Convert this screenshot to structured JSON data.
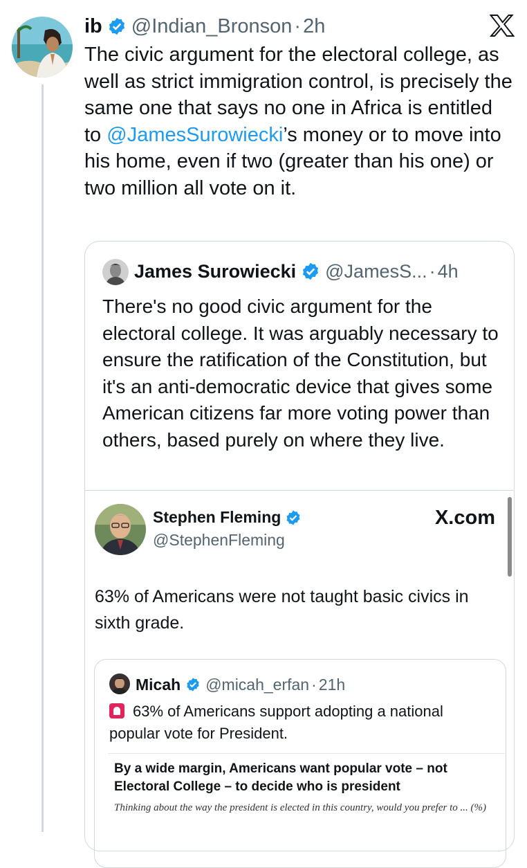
{
  "main_tweet": {
    "name": "ib",
    "handle": "@Indian_Bronson",
    "sep": "·",
    "time": "2h",
    "text_before": "The civic argument for the electoral college, as well as strict immigration control, is precisely the same one that says no one in Africa is entitled to ",
    "mention": "@JamesSurowiecki",
    "text_after": "’s money or to move into his home, even if two (greater than his one) or two million all vote on it.",
    "x_logo_icon": "x-logo-icon"
  },
  "quote1": {
    "name": "James Surowiecki",
    "handle": "@JamesS...",
    "sep": "·",
    "time": "4h",
    "text": "There's no good civic argument for the electoral college. It was arguably necessary to ensure the ratification of the Constitution, but it's an anti-democratic device that gives some American citizens far more voting power than others, based purely on where they live."
  },
  "embed": {
    "name": "Stephen Fleming",
    "handle": "@StephenFleming",
    "source": "X.com",
    "text": "63% of Americans were not taught basic civics in sixth grade."
  },
  "quote2": {
    "name": "Micah",
    "handle": "@micah_erfan",
    "sep": "·",
    "time": "21h",
    "text": "63% of Americans support adopting a national popular vote for President.",
    "media_headline": "By a wide margin, Americans want popular vote – not Electoral College – to decide who is president",
    "media_sub": "Thinking about the way the president is elected in this country, would you prefer to ... (%)"
  },
  "colors": {
    "verified": "#1d9bf0",
    "muted": "#536471",
    "border": "#cfd9de",
    "link": "#1d9bf0"
  }
}
